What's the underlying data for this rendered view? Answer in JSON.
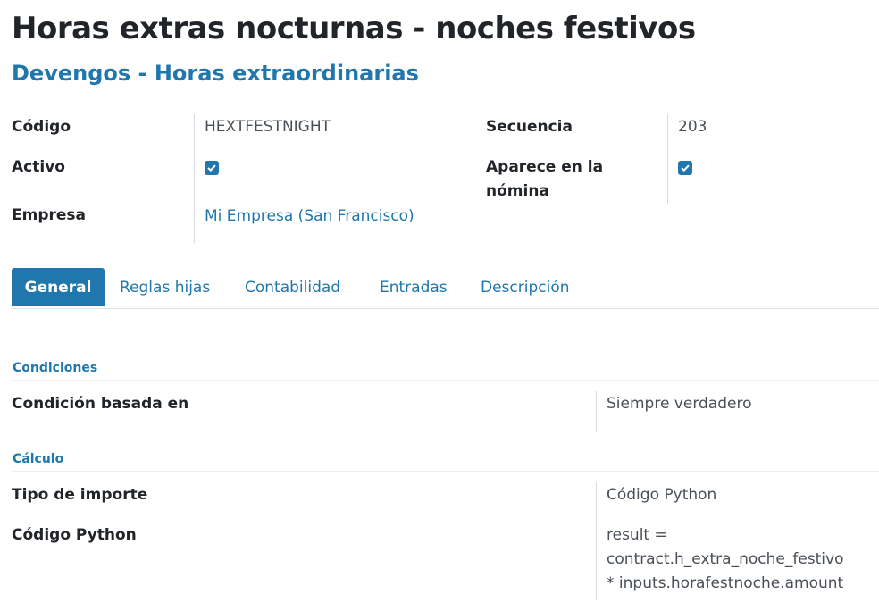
{
  "record": {
    "title": "Horas extras nocturnas - noches festivos",
    "category": "Devengos - Horas extraordinarias"
  },
  "fields": {
    "code_label": "Código",
    "code_value": "HEXTFESTNIGHT",
    "sequence_label": "Secuencia",
    "sequence_value": "203",
    "active_label": "Activo",
    "active_checked": true,
    "appears_label_line1": "Aparece en la",
    "appears_label_line2": "nómina",
    "appears_checked": true,
    "company_label": "Empresa",
    "company_value": "Mi Empresa (San Francisco)"
  },
  "tabs": [
    {
      "label": "General",
      "active": true
    },
    {
      "label": "Reglas hijas",
      "active": false
    },
    {
      "label": "Contabilidad",
      "active": false
    },
    {
      "label": "Entradas",
      "active": false
    },
    {
      "label": "Descripción",
      "active": false
    }
  ],
  "conditions": {
    "section_title": "Condiciones",
    "based_on_label": "Condición basada en",
    "based_on_value": "Siempre verdadero"
  },
  "calculation": {
    "section_title": "Cálculo",
    "amount_type_label": "Tipo de importe",
    "amount_type_value": "Código Python",
    "python_code_label": "Código Python",
    "python_code_line1": "result =",
    "python_code_line2": "contract.h_extra_noche_festivo",
    "python_code_line3": "* inputs.horafestnoche.amount"
  },
  "colors": {
    "accent": "#1f77ad",
    "text": "#212529",
    "muted": "#495057"
  }
}
